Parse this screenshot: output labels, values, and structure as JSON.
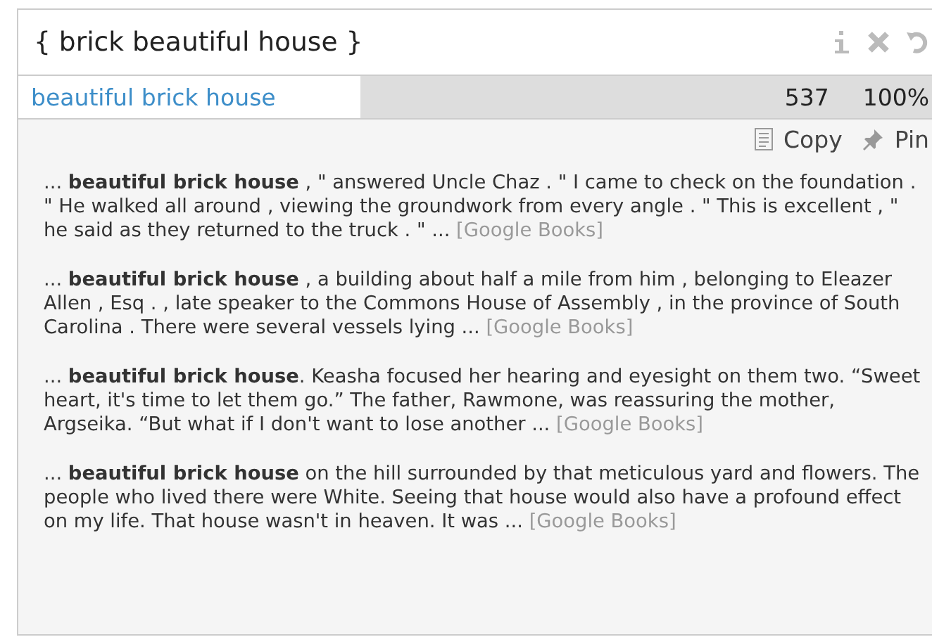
{
  "query": "{ brick beautiful house }",
  "result": {
    "phrase": "beautiful brick house",
    "count": "537",
    "share": "100%"
  },
  "actions": [
    {
      "kind": "copy",
      "label": "Copy"
    },
    {
      "kind": "pin",
      "label": "Pin"
    }
  ],
  "snippets": [
    {
      "text": "... **beautiful brick house** , \" answered Uncle Chaz . \" I came to check on the foundation . \" He walked all around , viewing the groundwork from every angle . \" This is excellent , \" he said as they returned to the truck . \" ...",
      "source": "[Google Books]"
    },
    {
      "text": "... **beautiful brick house** , a building about half a mile from him , belonging to Eleazer Allen , Esq . , late speaker to the Commons House of Assembly , in the province of South Carolina . There were several vessels lying ...",
      "source": "[Google Books]"
    },
    {
      "text": "... **beautiful brick house**. Keasha focused her hearing and eyesight on them two. “Sweet heart, it's time to let them go.” The father, Rawmone, was reassuring the mother, Argseika. “But what if I don't want to lose another ...",
      "source": "[Google Books]"
    },
    {
      "text": "... **beautiful brick house** on the hill surrounded by that meticulous yard and flowers. The people who lived there were White. Seeing that house would also have a profound effect on my life. That house wasn't in heaven. It was ...",
      "source": "[Google Books]"
    }
  ]
}
